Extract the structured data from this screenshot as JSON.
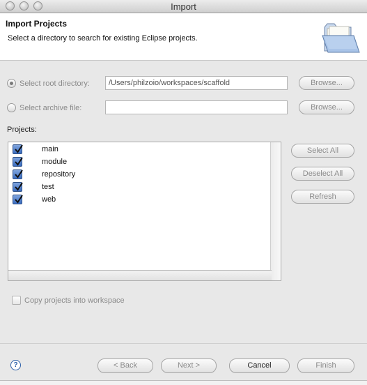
{
  "window": {
    "title": "Import"
  },
  "header": {
    "title": "Import Projects",
    "description": "Select a directory to search for existing Eclipse projects."
  },
  "source": {
    "root_label": "Select root directory:",
    "root_value": "/Users/philzoio/workspaces/scaffold",
    "root_selected": true,
    "archive_label": "Select archive file:",
    "archive_value": "",
    "browse_label": "Browse..."
  },
  "projects": {
    "label": "Projects:",
    "items": [
      {
        "name": "main",
        "checked": true
      },
      {
        "name": "module",
        "checked": true
      },
      {
        "name": "repository",
        "checked": true
      },
      {
        "name": "test",
        "checked": true
      },
      {
        "name": "web",
        "checked": true
      }
    ],
    "select_all": "Select All",
    "deselect_all": "Deselect All",
    "refresh": "Refresh"
  },
  "options": {
    "copy_label": "Copy projects into workspace",
    "copy_checked": false
  },
  "footer": {
    "help_icon": "?",
    "back": "< Back",
    "next": "Next >",
    "cancel": "Cancel",
    "finish": "Finish"
  }
}
